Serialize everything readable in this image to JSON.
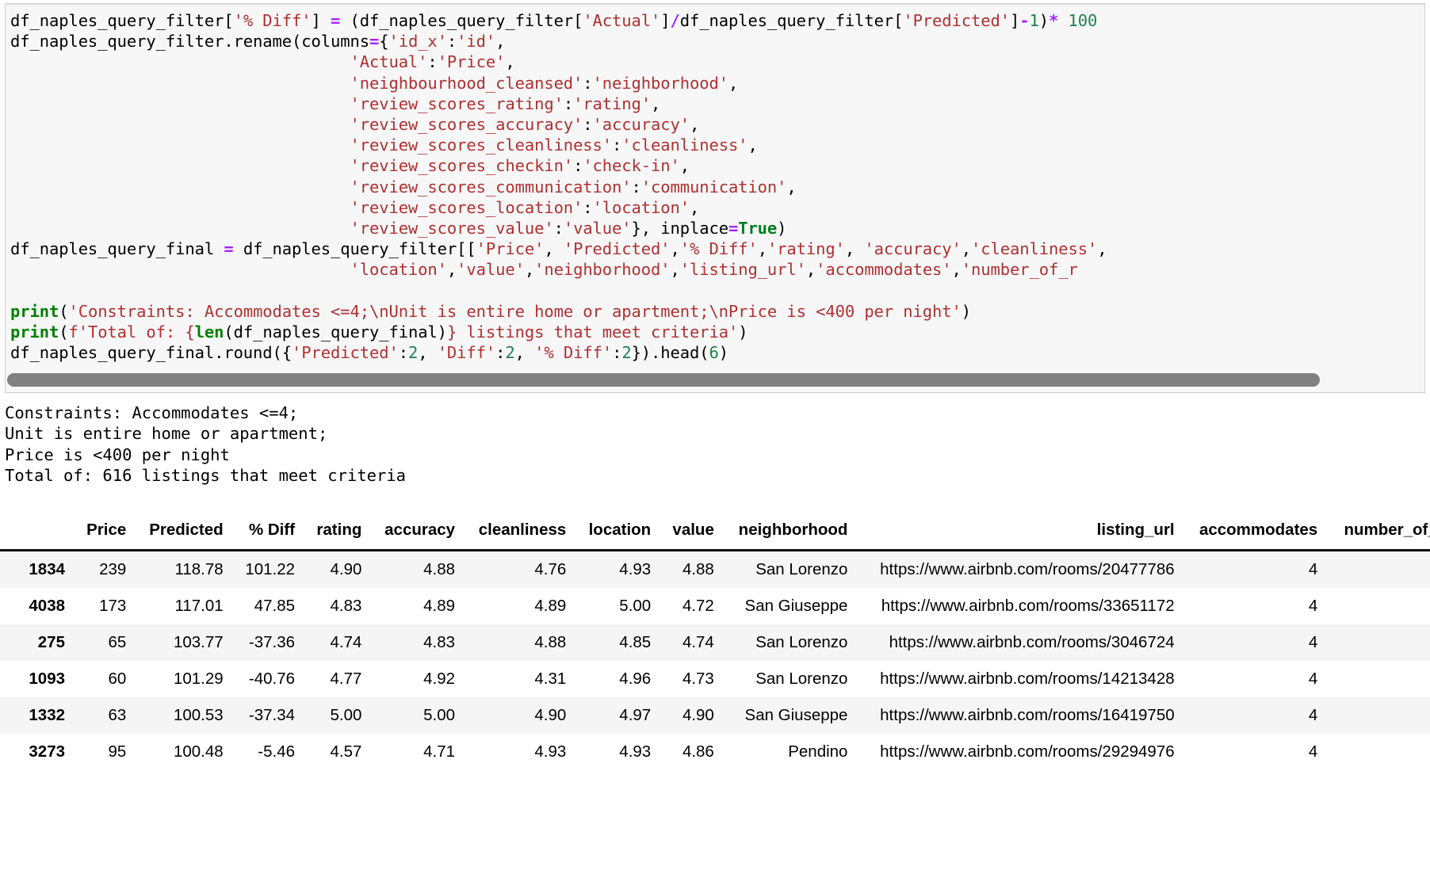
{
  "code_cell": {
    "lines": [
      [
        {
          "t": "df_naples_query_filter[",
          "c": "plain"
        },
        {
          "t": "'% Diff'",
          "c": "str"
        },
        {
          "t": "]",
          "c": "plain"
        },
        {
          "t": " = ",
          "c": "op"
        },
        {
          "t": "(df_naples_query_filter[",
          "c": "plain"
        },
        {
          "t": "'Actual'",
          "c": "str"
        },
        {
          "t": "]",
          "c": "plain"
        },
        {
          "t": "/",
          "c": "op"
        },
        {
          "t": "df_naples_query_filter[",
          "c": "plain"
        },
        {
          "t": "'Predicted'",
          "c": "str"
        },
        {
          "t": "]",
          "c": "plain"
        },
        {
          "t": "-",
          "c": "op"
        },
        {
          "t": "1",
          "c": "num"
        },
        {
          "t": ")",
          "c": "plain"
        },
        {
          "t": "* ",
          "c": "op"
        },
        {
          "t": "100",
          "c": "num"
        }
      ],
      [
        {
          "t": "df_naples_query_filter.rename(columns",
          "c": "plain"
        },
        {
          "t": "=",
          "c": "op"
        },
        {
          "t": "{",
          "c": "plain"
        },
        {
          "t": "'id_x'",
          "c": "str"
        },
        {
          "t": ":",
          "c": "plain"
        },
        {
          "t": "'id'",
          "c": "str"
        },
        {
          "t": ",",
          "c": "plain"
        }
      ],
      [
        {
          "t": "                                   ",
          "c": "plain"
        },
        {
          "t": "'Actual'",
          "c": "str"
        },
        {
          "t": ":",
          "c": "plain"
        },
        {
          "t": "'Price'",
          "c": "str"
        },
        {
          "t": ",",
          "c": "plain"
        }
      ],
      [
        {
          "t": "                                   ",
          "c": "plain"
        },
        {
          "t": "'neighbourhood_cleansed'",
          "c": "str"
        },
        {
          "t": ":",
          "c": "plain"
        },
        {
          "t": "'neighborhood'",
          "c": "str"
        },
        {
          "t": ",",
          "c": "plain"
        }
      ],
      [
        {
          "t": "                                   ",
          "c": "plain"
        },
        {
          "t": "'review_scores_rating'",
          "c": "str"
        },
        {
          "t": ":",
          "c": "plain"
        },
        {
          "t": "'rating'",
          "c": "str"
        },
        {
          "t": ",",
          "c": "plain"
        }
      ],
      [
        {
          "t": "                                   ",
          "c": "plain"
        },
        {
          "t": "'review_scores_accuracy'",
          "c": "str"
        },
        {
          "t": ":",
          "c": "plain"
        },
        {
          "t": "'accuracy'",
          "c": "str"
        },
        {
          "t": ",",
          "c": "plain"
        }
      ],
      [
        {
          "t": "                                   ",
          "c": "plain"
        },
        {
          "t": "'review_scores_cleanliness'",
          "c": "str"
        },
        {
          "t": ":",
          "c": "plain"
        },
        {
          "t": "'cleanliness'",
          "c": "str"
        },
        {
          "t": ",",
          "c": "plain"
        }
      ],
      [
        {
          "t": "                                   ",
          "c": "plain"
        },
        {
          "t": "'review_scores_checkin'",
          "c": "str"
        },
        {
          "t": ":",
          "c": "plain"
        },
        {
          "t": "'check-in'",
          "c": "str"
        },
        {
          "t": ",",
          "c": "plain"
        }
      ],
      [
        {
          "t": "                                   ",
          "c": "plain"
        },
        {
          "t": "'review_scores_communication'",
          "c": "str"
        },
        {
          "t": ":",
          "c": "plain"
        },
        {
          "t": "'communication'",
          "c": "str"
        },
        {
          "t": ",",
          "c": "plain"
        }
      ],
      [
        {
          "t": "                                   ",
          "c": "plain"
        },
        {
          "t": "'review_scores_location'",
          "c": "str"
        },
        {
          "t": ":",
          "c": "plain"
        },
        {
          "t": "'location'",
          "c": "str"
        },
        {
          "t": ",",
          "c": "plain"
        }
      ],
      [
        {
          "t": "                                   ",
          "c": "plain"
        },
        {
          "t": "'review_scores_value'",
          "c": "str"
        },
        {
          "t": ":",
          "c": "plain"
        },
        {
          "t": "'value'",
          "c": "str"
        },
        {
          "t": "}, inplace",
          "c": "plain"
        },
        {
          "t": "=",
          "c": "op"
        },
        {
          "t": "True",
          "c": "kw"
        },
        {
          "t": ")",
          "c": "plain"
        }
      ],
      [
        {
          "t": "df_naples_query_final",
          "c": "plain"
        },
        {
          "t": " = ",
          "c": "op"
        },
        {
          "t": "df_naples_query_filter[[",
          "c": "plain"
        },
        {
          "t": "'Price'",
          "c": "str"
        },
        {
          "t": ", ",
          "c": "plain"
        },
        {
          "t": "'Predicted'",
          "c": "str"
        },
        {
          "t": ",",
          "c": "plain"
        },
        {
          "t": "'% Diff'",
          "c": "str"
        },
        {
          "t": ",",
          "c": "plain"
        },
        {
          "t": "'rating'",
          "c": "str"
        },
        {
          "t": ", ",
          "c": "plain"
        },
        {
          "t": "'accuracy'",
          "c": "str"
        },
        {
          "t": ",",
          "c": "plain"
        },
        {
          "t": "'cleanliness'",
          "c": "str"
        },
        {
          "t": ",",
          "c": "plain"
        }
      ],
      [
        {
          "t": "                                   ",
          "c": "plain"
        },
        {
          "t": "'location'",
          "c": "str"
        },
        {
          "t": ",",
          "c": "plain"
        },
        {
          "t": "'value'",
          "c": "str"
        },
        {
          "t": ",",
          "c": "plain"
        },
        {
          "t": "'neighborhood'",
          "c": "str"
        },
        {
          "t": ",",
          "c": "plain"
        },
        {
          "t": "'listing_url'",
          "c": "str"
        },
        {
          "t": ",",
          "c": "plain"
        },
        {
          "t": "'accommodates'",
          "c": "str"
        },
        {
          "t": ",",
          "c": "plain"
        },
        {
          "t": "'number_of_r",
          "c": "str"
        }
      ],
      [],
      [
        {
          "t": "print",
          "c": "fn"
        },
        {
          "t": "(",
          "c": "plain"
        },
        {
          "t": "'Constraints: Accommodates <=4;\\nUnit is entire home or apartment;\\nPrice is <400 per night'",
          "c": "str"
        },
        {
          "t": ")",
          "c": "plain"
        }
      ],
      [
        {
          "t": "print",
          "c": "fn"
        },
        {
          "t": "(",
          "c": "plain"
        },
        {
          "t": "f'Total of: {",
          "c": "str"
        },
        {
          "t": "len",
          "c": "fn"
        },
        {
          "t": "(df_naples_query_final)",
          "c": "plain"
        },
        {
          "t": "} listings that meet criteria'",
          "c": "str"
        },
        {
          "t": ")",
          "c": "plain"
        }
      ],
      [
        {
          "t": "df_naples_query_final.round({",
          "c": "plain"
        },
        {
          "t": "'Predicted'",
          "c": "str"
        },
        {
          "t": ":",
          "c": "plain"
        },
        {
          "t": "2",
          "c": "num"
        },
        {
          "t": ", ",
          "c": "plain"
        },
        {
          "t": "'Diff'",
          "c": "str"
        },
        {
          "t": ":",
          "c": "plain"
        },
        {
          "t": "2",
          "c": "num"
        },
        {
          "t": ", ",
          "c": "plain"
        },
        {
          "t": "'% Diff'",
          "c": "str"
        },
        {
          "t": ":",
          "c": "plain"
        },
        {
          "t": "2",
          "c": "num"
        },
        {
          "t": "}).head(",
          "c": "plain"
        },
        {
          "t": "6",
          "c": "num"
        },
        {
          "t": ")",
          "c": "plain"
        }
      ]
    ],
    "scrollbar": {
      "name": "horizontal-scrollbar"
    }
  },
  "output_stream": {
    "lines": [
      "Constraints: Accommodates <=4;",
      "Unit is entire home or apartment;",
      "Price is <400 per night",
      "Total of: 616 listings that meet criteria"
    ]
  },
  "dataframe": {
    "index_header": "",
    "columns": [
      "Price",
      "Predicted",
      "% Diff",
      "rating",
      "accuracy",
      "cleanliness",
      "location",
      "value",
      "neighborhood",
      "listing_url",
      "accommodates",
      "number_of_reviews"
    ],
    "rows": [
      {
        "index": "1834",
        "cells": [
          "239",
          "118.78",
          "101.22",
          "4.90",
          "4.88",
          "4.76",
          "4.93",
          "4.88",
          "San Lorenzo",
          "https://www.airbnb.com/rooms/20477786",
          "4",
          ""
        ]
      },
      {
        "index": "4038",
        "cells": [
          "173",
          "117.01",
          "47.85",
          "4.83",
          "4.89",
          "4.89",
          "5.00",
          "4.72",
          "San Giuseppe",
          "https://www.airbnb.com/rooms/33651172",
          "4",
          ""
        ]
      },
      {
        "index": "275",
        "cells": [
          "65",
          "103.77",
          "-37.36",
          "4.74",
          "4.83",
          "4.88",
          "4.85",
          "4.74",
          "San Lorenzo",
          "https://www.airbnb.com/rooms/3046724",
          "4",
          ""
        ]
      },
      {
        "index": "1093",
        "cells": [
          "60",
          "101.29",
          "-40.76",
          "4.77",
          "4.92",
          "4.31",
          "4.96",
          "4.73",
          "San Lorenzo",
          "https://www.airbnb.com/rooms/14213428",
          "4",
          ""
        ]
      },
      {
        "index": "1332",
        "cells": [
          "63",
          "100.53",
          "-37.34",
          "5.00",
          "5.00",
          "4.90",
          "4.97",
          "4.90",
          "San Giuseppe",
          "https://www.airbnb.com/rooms/16419750",
          "4",
          ""
        ]
      },
      {
        "index": "3273",
        "cells": [
          "95",
          "100.48",
          "-5.46",
          "4.57",
          "4.71",
          "4.93",
          "4.93",
          "4.86",
          "Pendino",
          "https://www.airbnb.com/rooms/29294976",
          "4",
          ""
        ]
      }
    ]
  },
  "colors": {
    "string": "#b03030",
    "number": "#208050",
    "keyword": "#007f20",
    "operator": "#aa22ff",
    "function": "#008000",
    "cell_background": "#f7f7f7",
    "scrollbar_thumb": "#808080",
    "row_stripe": "#f5f5f5"
  }
}
